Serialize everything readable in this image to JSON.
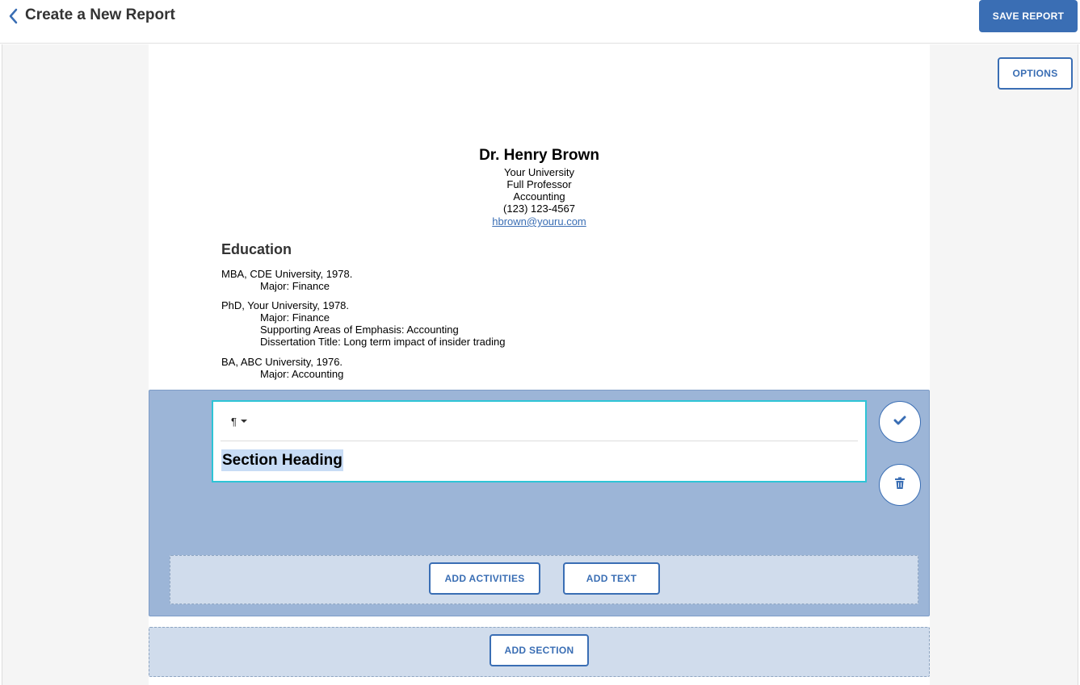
{
  "header": {
    "back_icon": "chevron-left-icon",
    "title": "Create a New Report",
    "save_label": "SAVE REPORT"
  },
  "options_label": "OPTIONS",
  "profile": {
    "name": "Dr. Henry Brown",
    "university": "Your University",
    "rank": "Full Professor",
    "department": "Accounting",
    "phone": "(123) 123-4567",
    "email": "hbrown@youru.com"
  },
  "education": {
    "title": "Education",
    "entries": [
      {
        "degree": "MBA, CDE University, 1978.",
        "details": [
          "Major: Finance"
        ]
      },
      {
        "degree": "PhD, Your University, 1978.",
        "details": [
          "Major: Finance",
          "Supporting Areas of Emphasis: Accounting",
          "Dissertation Title: Long term impact of insider trading"
        ]
      },
      {
        "degree": "BA, ABC University, 1976.",
        "details": [
          "Major: Accounting"
        ]
      }
    ]
  },
  "editor": {
    "paragraph_icon": "¶",
    "heading_value": "Section Heading",
    "confirm_icon": "check-icon",
    "delete_icon": "trash-icon",
    "add_activities_label": "ADD ACTIVITIES",
    "add_text_label": "ADD TEXT"
  },
  "add_section_label": "ADD SECTION",
  "colors": {
    "accent": "#3a6eb4",
    "editor_bg": "#9cb5d7",
    "dropzone_bg": "#d0dcec",
    "focus_border": "#2ec4d6"
  }
}
